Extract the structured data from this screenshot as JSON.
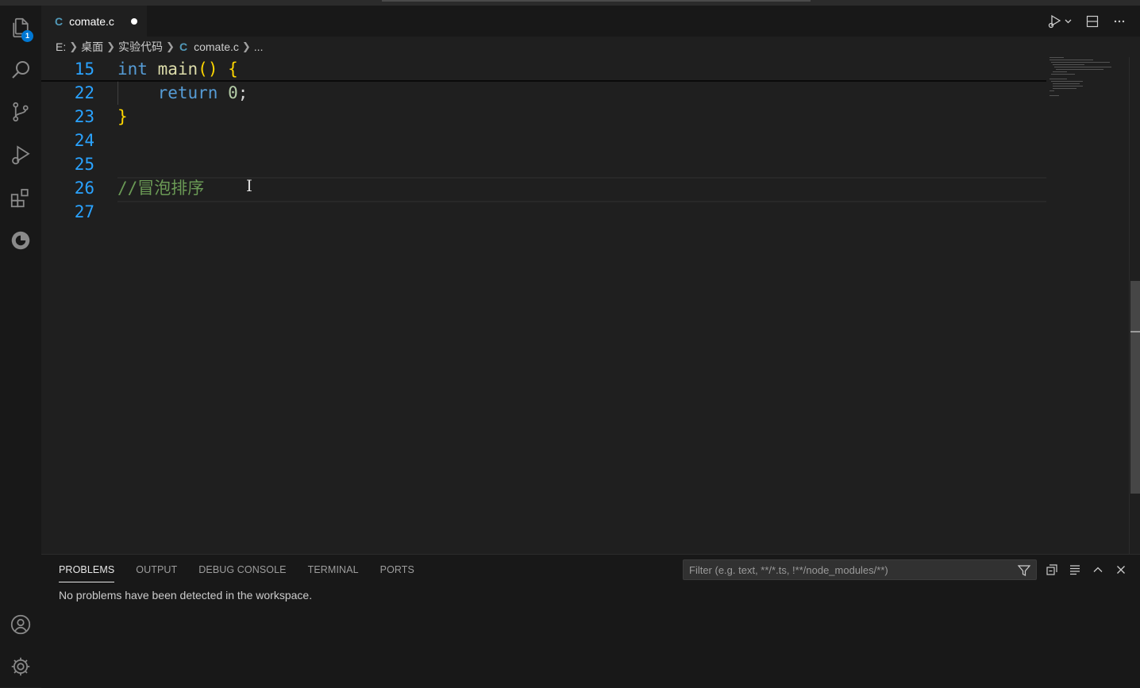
{
  "editor_tab": {
    "file_letter": "C",
    "file_name": "comate.c"
  },
  "breadcrumb": {
    "drive": "E:",
    "folder1": "桌面",
    "folder2": "实验代码",
    "file_letter": "C",
    "file": "comate.c",
    "more": "..."
  },
  "activity_bar": {
    "explorer_badge": "1"
  },
  "code_lines": [
    {
      "num": "15",
      "tokens": [
        {
          "t": "int",
          "c": "kw"
        },
        {
          "t": " ",
          "c": "plain"
        },
        {
          "t": "main",
          "c": "fn"
        },
        {
          "t": "()",
          "c": "br"
        },
        {
          "t": " ",
          "c": "plain"
        },
        {
          "t": "{",
          "c": "br"
        }
      ]
    },
    {
      "num": "22",
      "tokens": [
        {
          "t": "    ",
          "c": "plain"
        },
        {
          "t": "return",
          "c": "kw"
        },
        {
          "t": " ",
          "c": "plain"
        },
        {
          "t": "0",
          "c": "num"
        },
        {
          "t": ";",
          "c": "plain"
        }
      ]
    },
    {
      "num": "23",
      "tokens": [
        {
          "t": "}",
          "c": "br"
        }
      ]
    },
    {
      "num": "24",
      "tokens": []
    },
    {
      "num": "25",
      "tokens": []
    },
    {
      "num": "26",
      "tokens": [
        {
          "t": "//冒泡排序",
          "c": "comment"
        }
      ]
    },
    {
      "num": "27",
      "tokens": []
    }
  ],
  "panel": {
    "tabs": [
      "PROBLEMS",
      "OUTPUT",
      "DEBUG CONSOLE",
      "TERMINAL",
      "PORTS"
    ],
    "active_tab": "PROBLEMS",
    "filter_placeholder": "Filter (e.g. text, **/*.ts, !**/node_modules/**)",
    "message": "No problems have been detected in the workspace."
  }
}
